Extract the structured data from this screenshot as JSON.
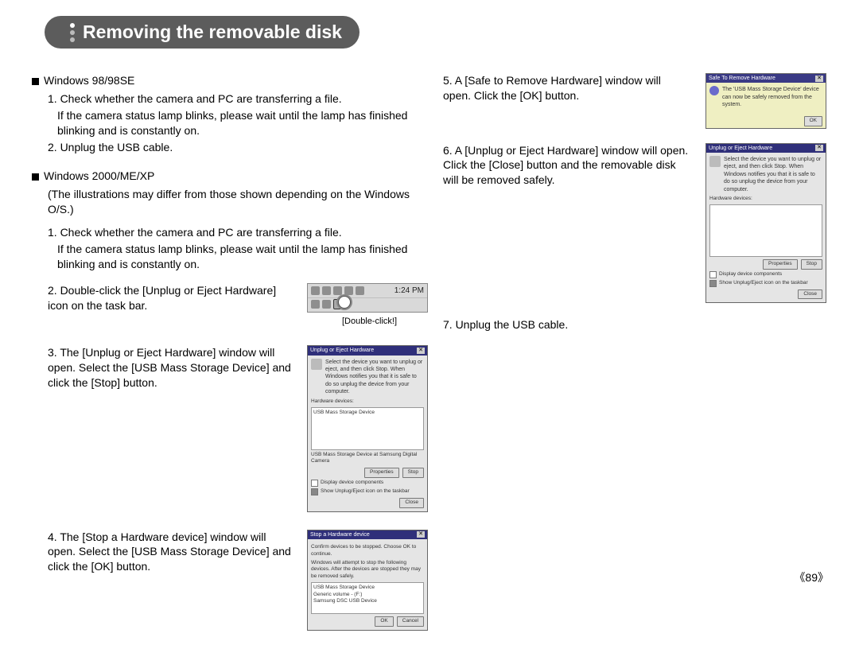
{
  "title": "Removing the removable disk",
  "page_number": "89",
  "left": {
    "section1_title": "Windows 98/98SE",
    "s1_step1": "1. Check whether the camera and PC are transferring a file.",
    "s1_step1b": "If the camera status lamp blinks, please wait until the lamp has finished blinking and is constantly on.",
    "s1_step2": "2. Unplug the USB cable.",
    "section2_title": "Windows 2000/ME/XP",
    "s2_note": "(The illustrations may differ from those shown depending on  the Windows O/S.)",
    "s2_step1": "1. Check whether the camera and PC are transferring a file.",
    "s2_step1b": "If the camera status lamp blinks, please wait until the lamp has finished blinking and is constantly on.",
    "s2_step2": "2. Double-click the [Unplug or Eject Hardware] icon on the task bar.",
    "taskbar_time": "1:24 PM",
    "taskbar_caption": "[Double-click!]",
    "s2_step3": "3. The [Unplug or Eject Hardware] window will open. Select the [USB Mass Storage Device] and click the [Stop] button.",
    "s2_step4": "4. The [Stop a Hardware device] window will open. Select the [USB Mass Storage Device] and click the [OK] button."
  },
  "right": {
    "step5": "5. A [Safe to Remove Hardware] window will open. Click the [OK] button.",
    "step6": "6. A [Unplug or Eject Hardware] window will open. Click the [Close] button and the removable disk will be removed safely.",
    "step7": "7. Unplug the USB cable."
  },
  "dialogs": {
    "unplug_title": "Unplug or Eject Hardware",
    "unplug_hint": "Select the device you want to unplug or eject, and then click Stop. When Windows notifies you that it is safe to do so unplug the device from your computer.",
    "hw_label": "Hardware devices:",
    "hw_item": "USB Mass Storage Device",
    "hw_desc": "USB Mass Storage Device at Samsung Digital Camera",
    "btn_properties": "Properties",
    "btn_stop": "Stop",
    "chk_display": "Display device components",
    "chk_show": "Show Unplug/Eject icon on the taskbar",
    "btn_close": "Close",
    "stop_title": "Stop a Hardware device",
    "stop_hint": "Confirm devices to be stopped. Choose OK to continue.",
    "stop_hint2": "Windows will attempt to stop the following devices. After the devices are stopped they may be removed safely.",
    "stop_item1": "USB Mass Storage Device",
    "stop_item2": "Generic volume - (F:)",
    "stop_item3": "Samsung DSC USB Device",
    "btn_ok": "OK",
    "btn_cancel": "Cancel",
    "safe_title": "Safe To Remove Hardware",
    "safe_msg": "The 'USB Mass Storage Device' device can now be safely removed from the system."
  }
}
